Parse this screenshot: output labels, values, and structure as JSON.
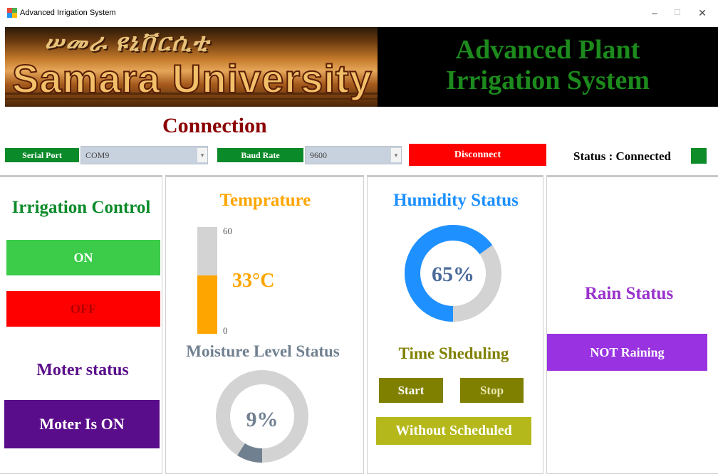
{
  "window": {
    "title": "Advanced Irrigation System",
    "minimize_glyph": "–",
    "maximize_glyph": "☐",
    "close_glyph": "✕"
  },
  "banner": {
    "amharic_text": "ሠመራ ዩኒቨርሲቲ",
    "university_name": "Samara University",
    "title_line1": "Advanced Plant",
    "title_line2": "Irrigation System"
  },
  "connection": {
    "heading": "Connection",
    "serial_port_label": "Serial Port",
    "serial_port_value": "COM9",
    "baud_rate_label": "Baud Rate",
    "baud_rate_value": "9600",
    "disconnect_label": "Disconnect",
    "status_text": "Status : Connected",
    "status_color": "#0e8c2a"
  },
  "irrigation_control": {
    "heading": "Irrigation Control",
    "on_label": "ON",
    "off_label": "OFF",
    "motor_heading": "Moter status",
    "motor_value": "Moter Is ON"
  },
  "temperature": {
    "heading": "Temprature",
    "max_label": "60",
    "min_label": "0",
    "value_text": "33°C",
    "fill_fraction": 0.55
  },
  "moisture": {
    "heading": "Moisture Level Status",
    "value_text": "9%",
    "fraction": 0.09
  },
  "humidity": {
    "heading": "Humidity Status",
    "value_text": "65%",
    "fraction": 0.65
  },
  "scheduling": {
    "heading": "Time Sheduling",
    "start_label": "Start",
    "stop_label": "Stop",
    "mode_label": "Without Scheduled"
  },
  "rain": {
    "heading": "Rain Status",
    "value": "NOT Raining"
  },
  "colors": {
    "connection_heading": "#8b0000",
    "irrigation_heading": "#0b8a2a",
    "on_button": "#3ccc4a",
    "off_button": "#ff0000",
    "motor_heading": "#5a0d8a",
    "motor_box": "#5a0d8a",
    "temperature": "#ffa500",
    "moisture_heading": "#708090",
    "humidity": "#1e90ff",
    "scheduling_heading": "#808000",
    "schedule_buttons": "#808000",
    "without_scheduled": "#b5b81a",
    "rain_heading": "#9932cc",
    "rain_box": "#9932e0"
  }
}
